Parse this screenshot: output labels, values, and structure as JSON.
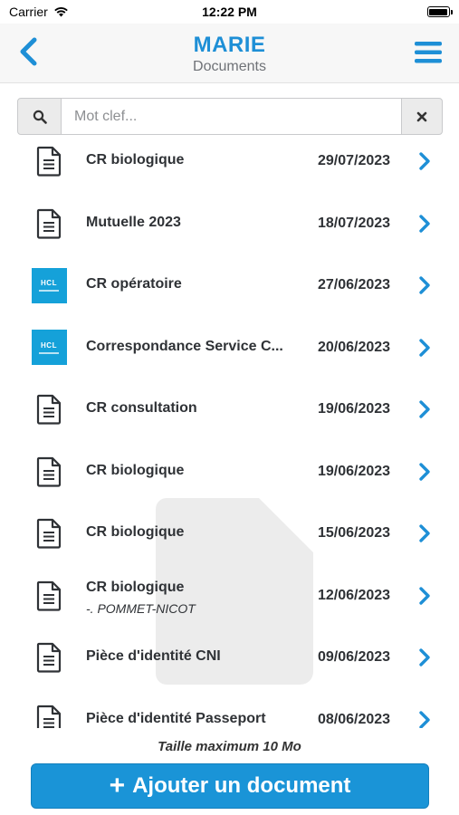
{
  "status_bar": {
    "carrier": "Carrier",
    "time": "12:22 PM"
  },
  "header": {
    "title": "MARIE",
    "subtitle": "Documents"
  },
  "search": {
    "placeholder": "Mot clef..."
  },
  "documents": [
    {
      "icon": "document-icon",
      "title": "CR biologique",
      "subtitle": "",
      "date": "29/07/2023"
    },
    {
      "icon": "document-icon",
      "title": "Mutuelle 2023",
      "subtitle": "",
      "date": "18/07/2023"
    },
    {
      "icon": "hcl-logo",
      "title": "CR opératoire",
      "subtitle": "",
      "date": "27/06/2023"
    },
    {
      "icon": "hcl-logo",
      "title": "Correspondance Service C...",
      "subtitle": "",
      "date": "20/06/2023"
    },
    {
      "icon": "document-icon",
      "title": "CR consultation",
      "subtitle": "",
      "date": "19/06/2023"
    },
    {
      "icon": "document-icon",
      "title": "CR biologique",
      "subtitle": "",
      "date": "19/06/2023"
    },
    {
      "icon": "document-icon",
      "title": "CR biologique",
      "subtitle": "",
      "date": "15/06/2023"
    },
    {
      "icon": "document-icon",
      "title": "CR biologique",
      "subtitle": "-. POMMET-NICOT",
      "date": "12/06/2023"
    },
    {
      "icon": "document-icon",
      "title": "Pièce d'identité CNI",
      "subtitle": "",
      "date": "09/06/2023"
    },
    {
      "icon": "document-icon",
      "title": "Pièce d'identité Passeport",
      "subtitle": "",
      "date": "08/06/2023"
    }
  ],
  "hcl_logo_text": "HCL",
  "footer": {
    "max_size_note": "Taille maximum 10 Mo",
    "add_button_label": "Ajouter un document",
    "add_button_icon": "plus-icon"
  },
  "colors": {
    "accent": "#1e8fd6",
    "button": "#1a94d7",
    "hcl_blue": "#15a1d9"
  }
}
